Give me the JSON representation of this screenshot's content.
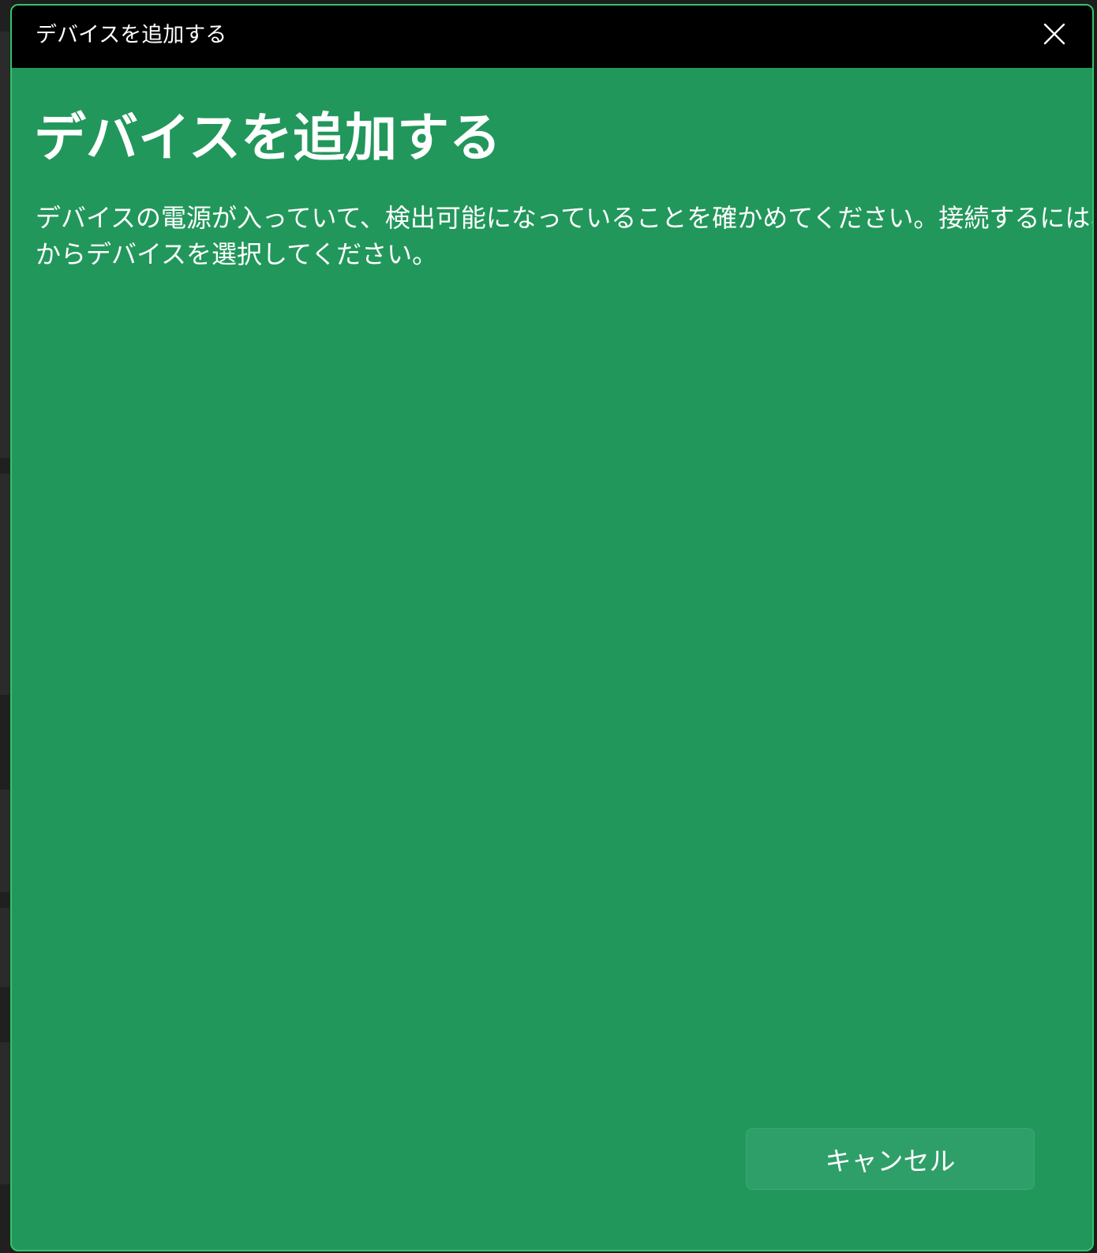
{
  "window": {
    "title": "デバイスを追加する"
  },
  "main": {
    "heading": "デバイスを追加する",
    "description_line1": "デバイスの電源が入っていて、検出可能になっていることを確かめてください。接続するには、以下",
    "description_line2": "からデバイスを選択してください。"
  },
  "footer": {
    "cancel_label": "キャンセル"
  },
  "icons": {
    "close": "close-icon"
  },
  "colors": {
    "dialog_background": "#22975b",
    "dialog_border": "#33c46a",
    "titlebar_background": "#000000",
    "button_background": "#2f9f69",
    "text": "#ffffff"
  }
}
